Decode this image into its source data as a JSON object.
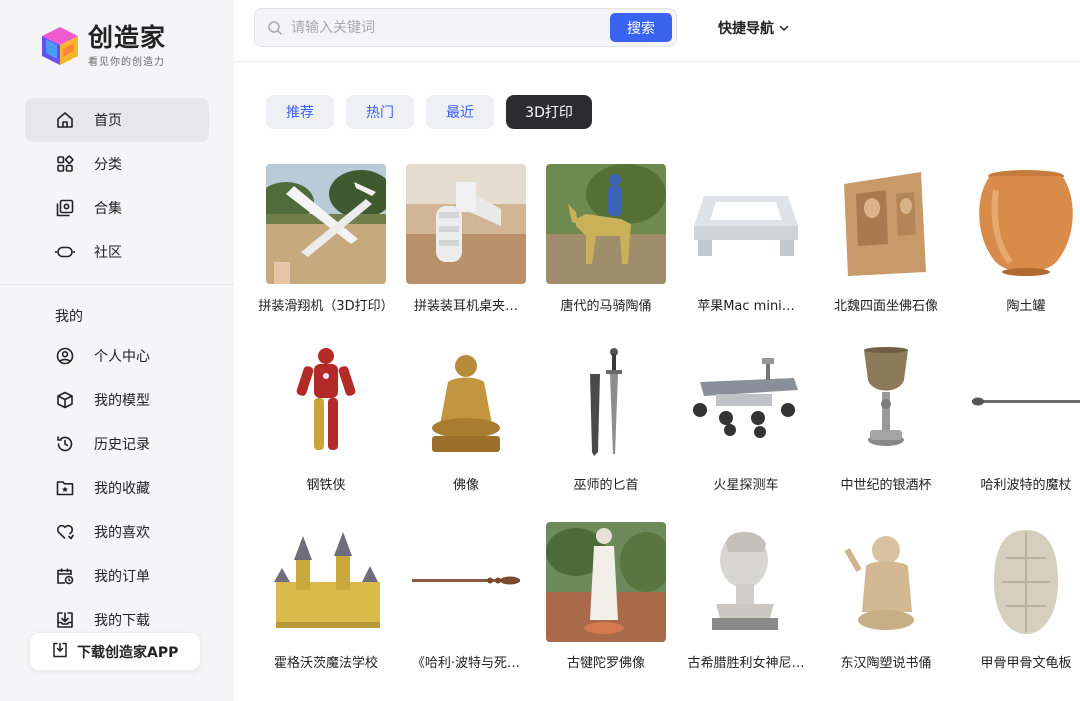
{
  "brand": {
    "title": "创造家",
    "subtitle": "看见你的创造力"
  },
  "sidebar": {
    "main_items": [
      {
        "label": "首页",
        "icon": "home-icon",
        "active": true
      },
      {
        "label": "分类",
        "icon": "category-icon"
      },
      {
        "label": "合集",
        "icon": "collection-icon"
      },
      {
        "label": "社区",
        "icon": "community-icon"
      }
    ],
    "section_title": "我的",
    "mine_items": [
      {
        "label": "个人中心",
        "icon": "user-circle-icon"
      },
      {
        "label": "我的模型",
        "icon": "cube-icon"
      },
      {
        "label": "历史记录",
        "icon": "history-icon"
      },
      {
        "label": "我的收藏",
        "icon": "star-folder-icon"
      },
      {
        "label": "我的喜欢",
        "icon": "heart-icon"
      },
      {
        "label": "我的订单",
        "icon": "calendar-clock-icon"
      },
      {
        "label": "我的下载",
        "icon": "download-tray-icon"
      }
    ],
    "app_button": "下载创造家APP"
  },
  "header": {
    "search_placeholder": "请输入关键词",
    "search_button": "搜索",
    "quick_nav": "快捷导航"
  },
  "tabs": [
    {
      "label": "推荐"
    },
    {
      "label": "热门"
    },
    {
      "label": "最近"
    },
    {
      "label": "3D打印",
      "active": true
    }
  ],
  "models": [
    {
      "title": "拼装滑翔机（3D打印）"
    },
    {
      "title": "拼装装耳机桌夹…"
    },
    {
      "title": "唐代的马骑陶俑"
    },
    {
      "title": "苹果Mac mini…"
    },
    {
      "title": "北魏四面坐佛石像"
    },
    {
      "title": "陶土罐"
    },
    {
      "title": "钢铁侠"
    },
    {
      "title": "佛像"
    },
    {
      "title": "巫师的匕首"
    },
    {
      "title": "火星探测车"
    },
    {
      "title": "中世纪的银酒杯"
    },
    {
      "title": "哈利波特的魔杖"
    },
    {
      "title": "霍格沃茨魔法学校"
    },
    {
      "title": "《哈利·波特与死…"
    },
    {
      "title": "古犍陀罗佛像"
    },
    {
      "title": "古希腊胜利女神尼…"
    },
    {
      "title": "东汉陶塑说书俑"
    },
    {
      "title": "甲骨甲骨文龟板"
    }
  ],
  "colors": {
    "accent": "#3a63f0",
    "active_tab": "#2c2c2e",
    "sidebar_bg": "#f5f5f7"
  }
}
